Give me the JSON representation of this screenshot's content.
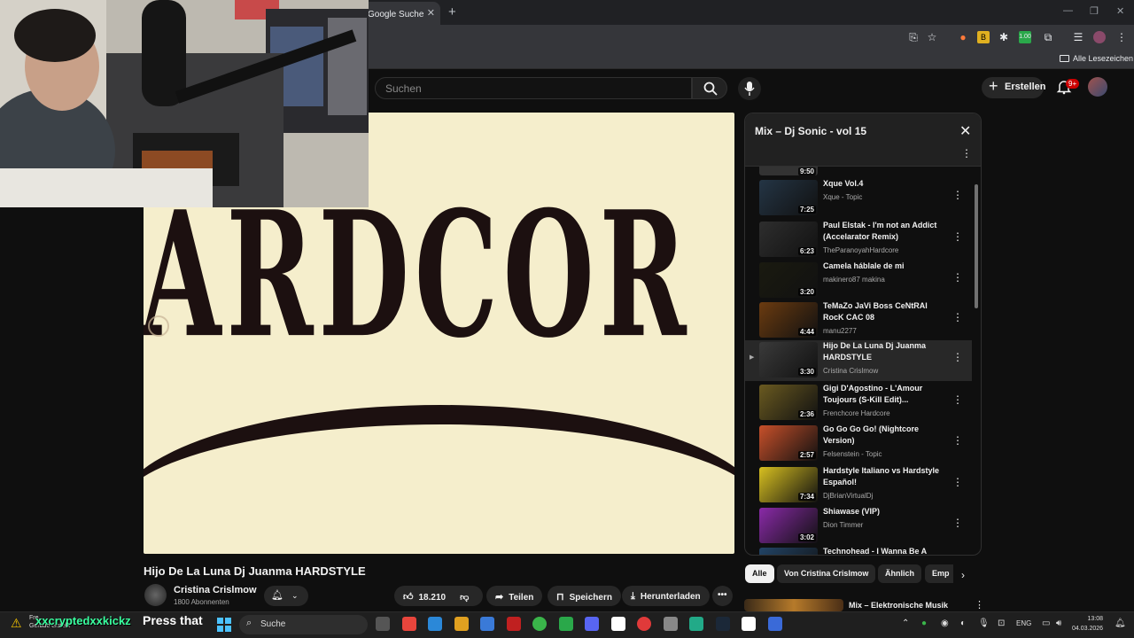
{
  "browser": {
    "tab_title": "Google Suche",
    "bookmarks_label": "Alle Lesezeichen"
  },
  "header": {
    "search_placeholder": "Suchen",
    "create_label": "Erstellen",
    "notif_count": "9+"
  },
  "video": {
    "overlay_text": "ARDCOR",
    "title": "Hijo De La Luna Dj Juanma HARDSTYLE",
    "channel": "Cristina Crislmow",
    "subscribers": "1800 Abonnenten",
    "likes": "18.210",
    "share_label": "Teilen",
    "save_label": "Speichern",
    "download_label": "Herunterladen"
  },
  "playlist": {
    "title": "Mix – Dj Sonic - vol 15",
    "items": [
      {
        "title": "Xque Vol.4",
        "channel": "Xque - Topic",
        "duration": "7:25",
        "color": "#243545"
      },
      {
        "title": "Paul Elstak - I'm not an Addict (Accelarator Remix)",
        "channel": "TheParanoyahHardcore",
        "duration": "6:23",
        "color": "#2e2e2e"
      },
      {
        "title": "Camela háblale de mi",
        "channel": "makinero87 makina",
        "duration": "3:20",
        "color": "#1a1a10"
      },
      {
        "title": "TeMaZo JaVi Boss CeNtRAl RocK CAC 08",
        "channel": "manu2277",
        "duration": "4:44",
        "color": "#6b3b10"
      },
      {
        "title": "Hijo De La Luna Dj Juanma HARDSTYLE",
        "channel": "Cristina Crislmow",
        "duration": "3:30",
        "color": "#3a3a3a"
      },
      {
        "title": "Gigi D'Agostino - L'Amour Toujours (S-Kill Edit)...",
        "channel": "Frenchcore Hardcore",
        "duration": "2:36",
        "color": "#6a5a20"
      },
      {
        "title": "Go Go Go Go! (Nightcore Version)",
        "channel": "Felsenstein - Topic",
        "duration": "2:57",
        "color": "#c8502a"
      },
      {
        "title": "Hardstyle Italiano vs Hardstyle Español!",
        "channel": "DjBrianVirtualDj",
        "duration": "7:34",
        "color": "#d8c020"
      },
      {
        "title": "Shiawase (VIP)",
        "channel": "Dion Timmer",
        "duration": "3:02",
        "color": "#8a2aa8"
      },
      {
        "title": "Technohead - I Wanna Be A",
        "channel": "",
        "duration": "",
        "color": "#224466"
      }
    ],
    "top_duration": "9:50"
  },
  "chips": [
    "Alle",
    "Von Cristina Crislmow",
    "Ähnlich",
    "Emp"
  ],
  "next_mix": "Mix – Elektronische Musik",
  "taskbar": {
    "notify_line1": "Fre...",
    "notify_line2": "Gerade erstellt",
    "twitch_user": "xxcryptedxxkickz",
    "press_text": "Press that",
    "search_label": "Suche",
    "lang": "ENG",
    "time": "13:08",
    "date": "04.03.2026"
  }
}
